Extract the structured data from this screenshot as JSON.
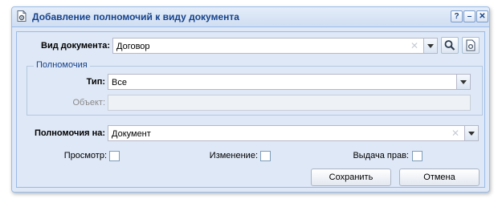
{
  "window": {
    "title": "Добавление полномочий к виду документа",
    "tools": {
      "help": "?",
      "minimize": "–",
      "close": "✕"
    }
  },
  "form": {
    "doc_type": {
      "label": "Вид документа:",
      "value": "Договор"
    },
    "group": {
      "legend": "Полномочия",
      "type": {
        "label": "Тип:",
        "value": "Все"
      },
      "object": {
        "label": "Объект:",
        "value": ""
      }
    },
    "rights_on": {
      "label": "Полномочия на:",
      "value": "Документ"
    },
    "checks": [
      {
        "label": "Просмотр:",
        "checked": false
      },
      {
        "label": "Изменение:",
        "checked": false
      },
      {
        "label": "Выдача прав:",
        "checked": false
      }
    ]
  },
  "buttons": {
    "save": "Сохранить",
    "cancel": "Отмена"
  },
  "icons": {
    "window_icon": "document-gear-icon",
    "search_button": "search-icon",
    "open_button": "document-gear-icon",
    "clear": "clear-x-icon",
    "dropdown": "chevron-down-icon"
  },
  "colors": {
    "title": "#15428b",
    "panel": "#dfe8f6",
    "border": "#99bbe8"
  }
}
